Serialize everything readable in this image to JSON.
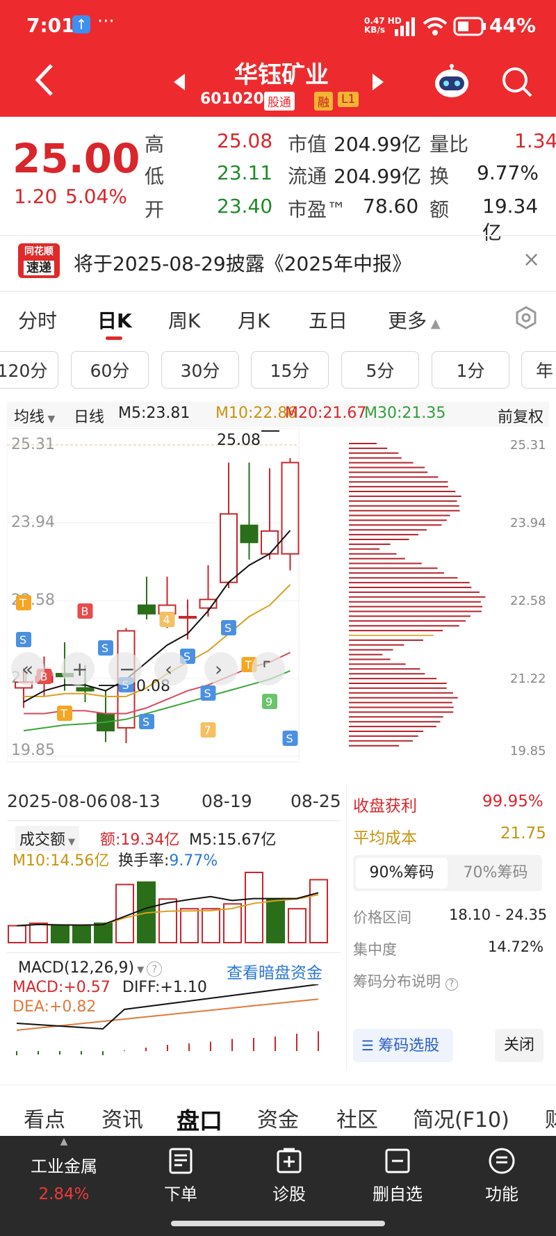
{
  "status": {
    "time": "7:01",
    "speed_top": "0.47",
    "speed_bottom": "KB/s",
    "battery": "44%",
    "net": "HD"
  },
  "header": {
    "title": "华钰矿业",
    "code": "601020",
    "tags": [
      "股通",
      "融",
      "L1"
    ]
  },
  "quote": {
    "price": "25.00",
    "change": "1.20",
    "pct": "5.04%",
    "rows": [
      {
        "l1": "高",
        "v1": "25.08",
        "l2": "市值",
        "v2": "204.99亿",
        "l3": "量比",
        "v3": "1.34"
      },
      {
        "l1": "低",
        "v1": "23.11",
        "l2": "流通",
        "v2": "204.99亿",
        "l3": "换",
        "v3": "9.77%"
      },
      {
        "l1": "开",
        "v1": "23.40",
        "l2": "市盈™",
        "v2": "78.60",
        "l3": "额",
        "v3": "19.34亿"
      }
    ]
  },
  "news": {
    "logo_top": "同花顺",
    "logo_bottom": "速递",
    "text": "将于2025-08-29披露《2025年中报》",
    "close": "×"
  },
  "tabs": [
    "分时",
    "日K",
    "周K",
    "月K",
    "五日",
    "更多"
  ],
  "periods": [
    "120分",
    "60分",
    "30分",
    "15分",
    "5分",
    "1分",
    "年"
  ],
  "ma": {
    "label": "均线",
    "line": "日线",
    "m5": "M5:23.81",
    "m10": "M10:22.86",
    "m20": "M20:21.67",
    "m30": "M30:21.35",
    "adj": "前复权"
  },
  "kline": {
    "y_labels": [
      "25.31",
      "23.94",
      "22.58",
      "21.22",
      "19.85"
    ],
    "high_label": "25.08",
    "low_label": "20.08",
    "dates": [
      "2025-08-06",
      "08-13",
      "08-19",
      "08-25"
    ],
    "markers": [
      "T",
      "S",
      "B",
      "T",
      "B",
      "S",
      "S",
      "S",
      "4",
      "S",
      "S",
      "7",
      "S",
      "T",
      "9",
      "S"
    ],
    "candles": [
      {
        "o": 21.05,
        "c": 21.15,
        "h": 21.4,
        "l": 20.7
      },
      {
        "o": 21.15,
        "c": 21.25,
        "h": 21.6,
        "l": 20.9
      },
      {
        "o": 21.3,
        "c": 21.25,
        "h": 21.85,
        "l": 21.0
      },
      {
        "o": 21.05,
        "c": 21.0,
        "h": 21.45,
        "l": 20.8
      },
      {
        "o": 20.6,
        "c": 20.3,
        "h": 21.0,
        "l": 20.1
      },
      {
        "o": 20.35,
        "c": 22.05,
        "h": 22.1,
        "l": 20.08
      },
      {
        "o": 22.5,
        "c": 22.35,
        "h": 23.0,
        "l": 22.25
      },
      {
        "o": 22.35,
        "c": 22.5,
        "h": 23.0,
        "l": 22.1
      },
      {
        "o": 22.3,
        "c": 22.3,
        "h": 22.6,
        "l": 21.9
      },
      {
        "o": 22.45,
        "c": 22.6,
        "h": 23.2,
        "l": 22.3
      },
      {
        "o": 22.9,
        "c": 24.1,
        "h": 25.0,
        "l": 22.8
      },
      {
        "o": 23.9,
        "c": 23.6,
        "h": 25.0,
        "l": 23.3
      },
      {
        "o": 23.4,
        "c": 23.8,
        "h": 24.9,
        "l": 23.3
      },
      {
        "o": 23.4,
        "c": 25.0,
        "h": 25.08,
        "l": 23.11
      }
    ],
    "ma5": [
      20.8,
      21.0,
      21.1,
      21.1,
      21.0,
      21.2,
      21.5,
      21.8,
      22.0,
      22.4,
      22.9,
      23.2,
      23.4,
      23.81
    ],
    "ma10": [
      20.9,
      20.9,
      20.95,
      20.95,
      20.9,
      20.9,
      21.05,
      21.3,
      21.5,
      21.7,
      22.0,
      22.3,
      22.5,
      22.86
    ],
    "ma20": [
      20.6,
      20.6,
      20.65,
      20.65,
      20.6,
      20.6,
      20.7,
      20.85,
      21.0,
      21.1,
      21.25,
      21.4,
      21.5,
      21.67
    ],
    "ma30": [
      20.3,
      20.35,
      20.4,
      20.42,
      20.45,
      20.5,
      20.6,
      20.7,
      20.8,
      20.9,
      21.0,
      21.1,
      21.2,
      21.35
    ]
  },
  "chips": {
    "y_labels": [
      "25.31",
      "23.94",
      "22.58",
      "21.22",
      "19.85"
    ],
    "profit_label": "收盘获利",
    "profit": "99.95%",
    "cost_label": "平均成本",
    "cost": "21.75",
    "tab90": "90%筹码",
    "tab70": "70%筹码",
    "range_label": "价格区间",
    "range": "18.10 - 24.35",
    "conc_label": "集中度",
    "conc": "14.72%",
    "explain": "筹码分布说明",
    "select": "筹码选股",
    "close": "关闭"
  },
  "volume": {
    "label": "成交额",
    "amt": "额:19.34亿",
    "m5": "M5:15.67亿",
    "m10": "M10:14.56亿",
    "turn_label": "换手率:",
    "turn": "9.77%",
    "values": [
      7,
      8,
      7,
      7,
      8,
      24,
      25,
      18,
      14,
      14,
      16,
      29,
      18,
      14,
      26
    ],
    "rise": [
      true,
      true,
      false,
      false,
      false,
      true,
      false,
      true,
      true,
      true,
      true,
      true,
      false,
      true,
      true
    ]
  },
  "macd": {
    "label": "MACD(12,26,9)",
    "link": "查看暗盘资金",
    "macd": "MACD:+0.57",
    "diff": "DIFF:+1.10",
    "dea": "DEA:+0.82",
    "hist": [
      -0.12,
      -0.1,
      -0.1,
      -0.1,
      -0.12,
      0.02,
      0.1,
      0.18,
      0.22,
      0.27,
      0.35,
      0.38,
      0.42,
      0.5,
      0.57
    ]
  },
  "bottom_tabs": [
    "看点",
    "资讯",
    "盘口",
    "资金",
    "社区",
    "简况(F10)",
    "财"
  ],
  "bottom_bar": {
    "sector": "工业金属",
    "sector_pct": "2.84%",
    "items": [
      "下单",
      "诊股",
      "删自选",
      "功能"
    ]
  }
}
